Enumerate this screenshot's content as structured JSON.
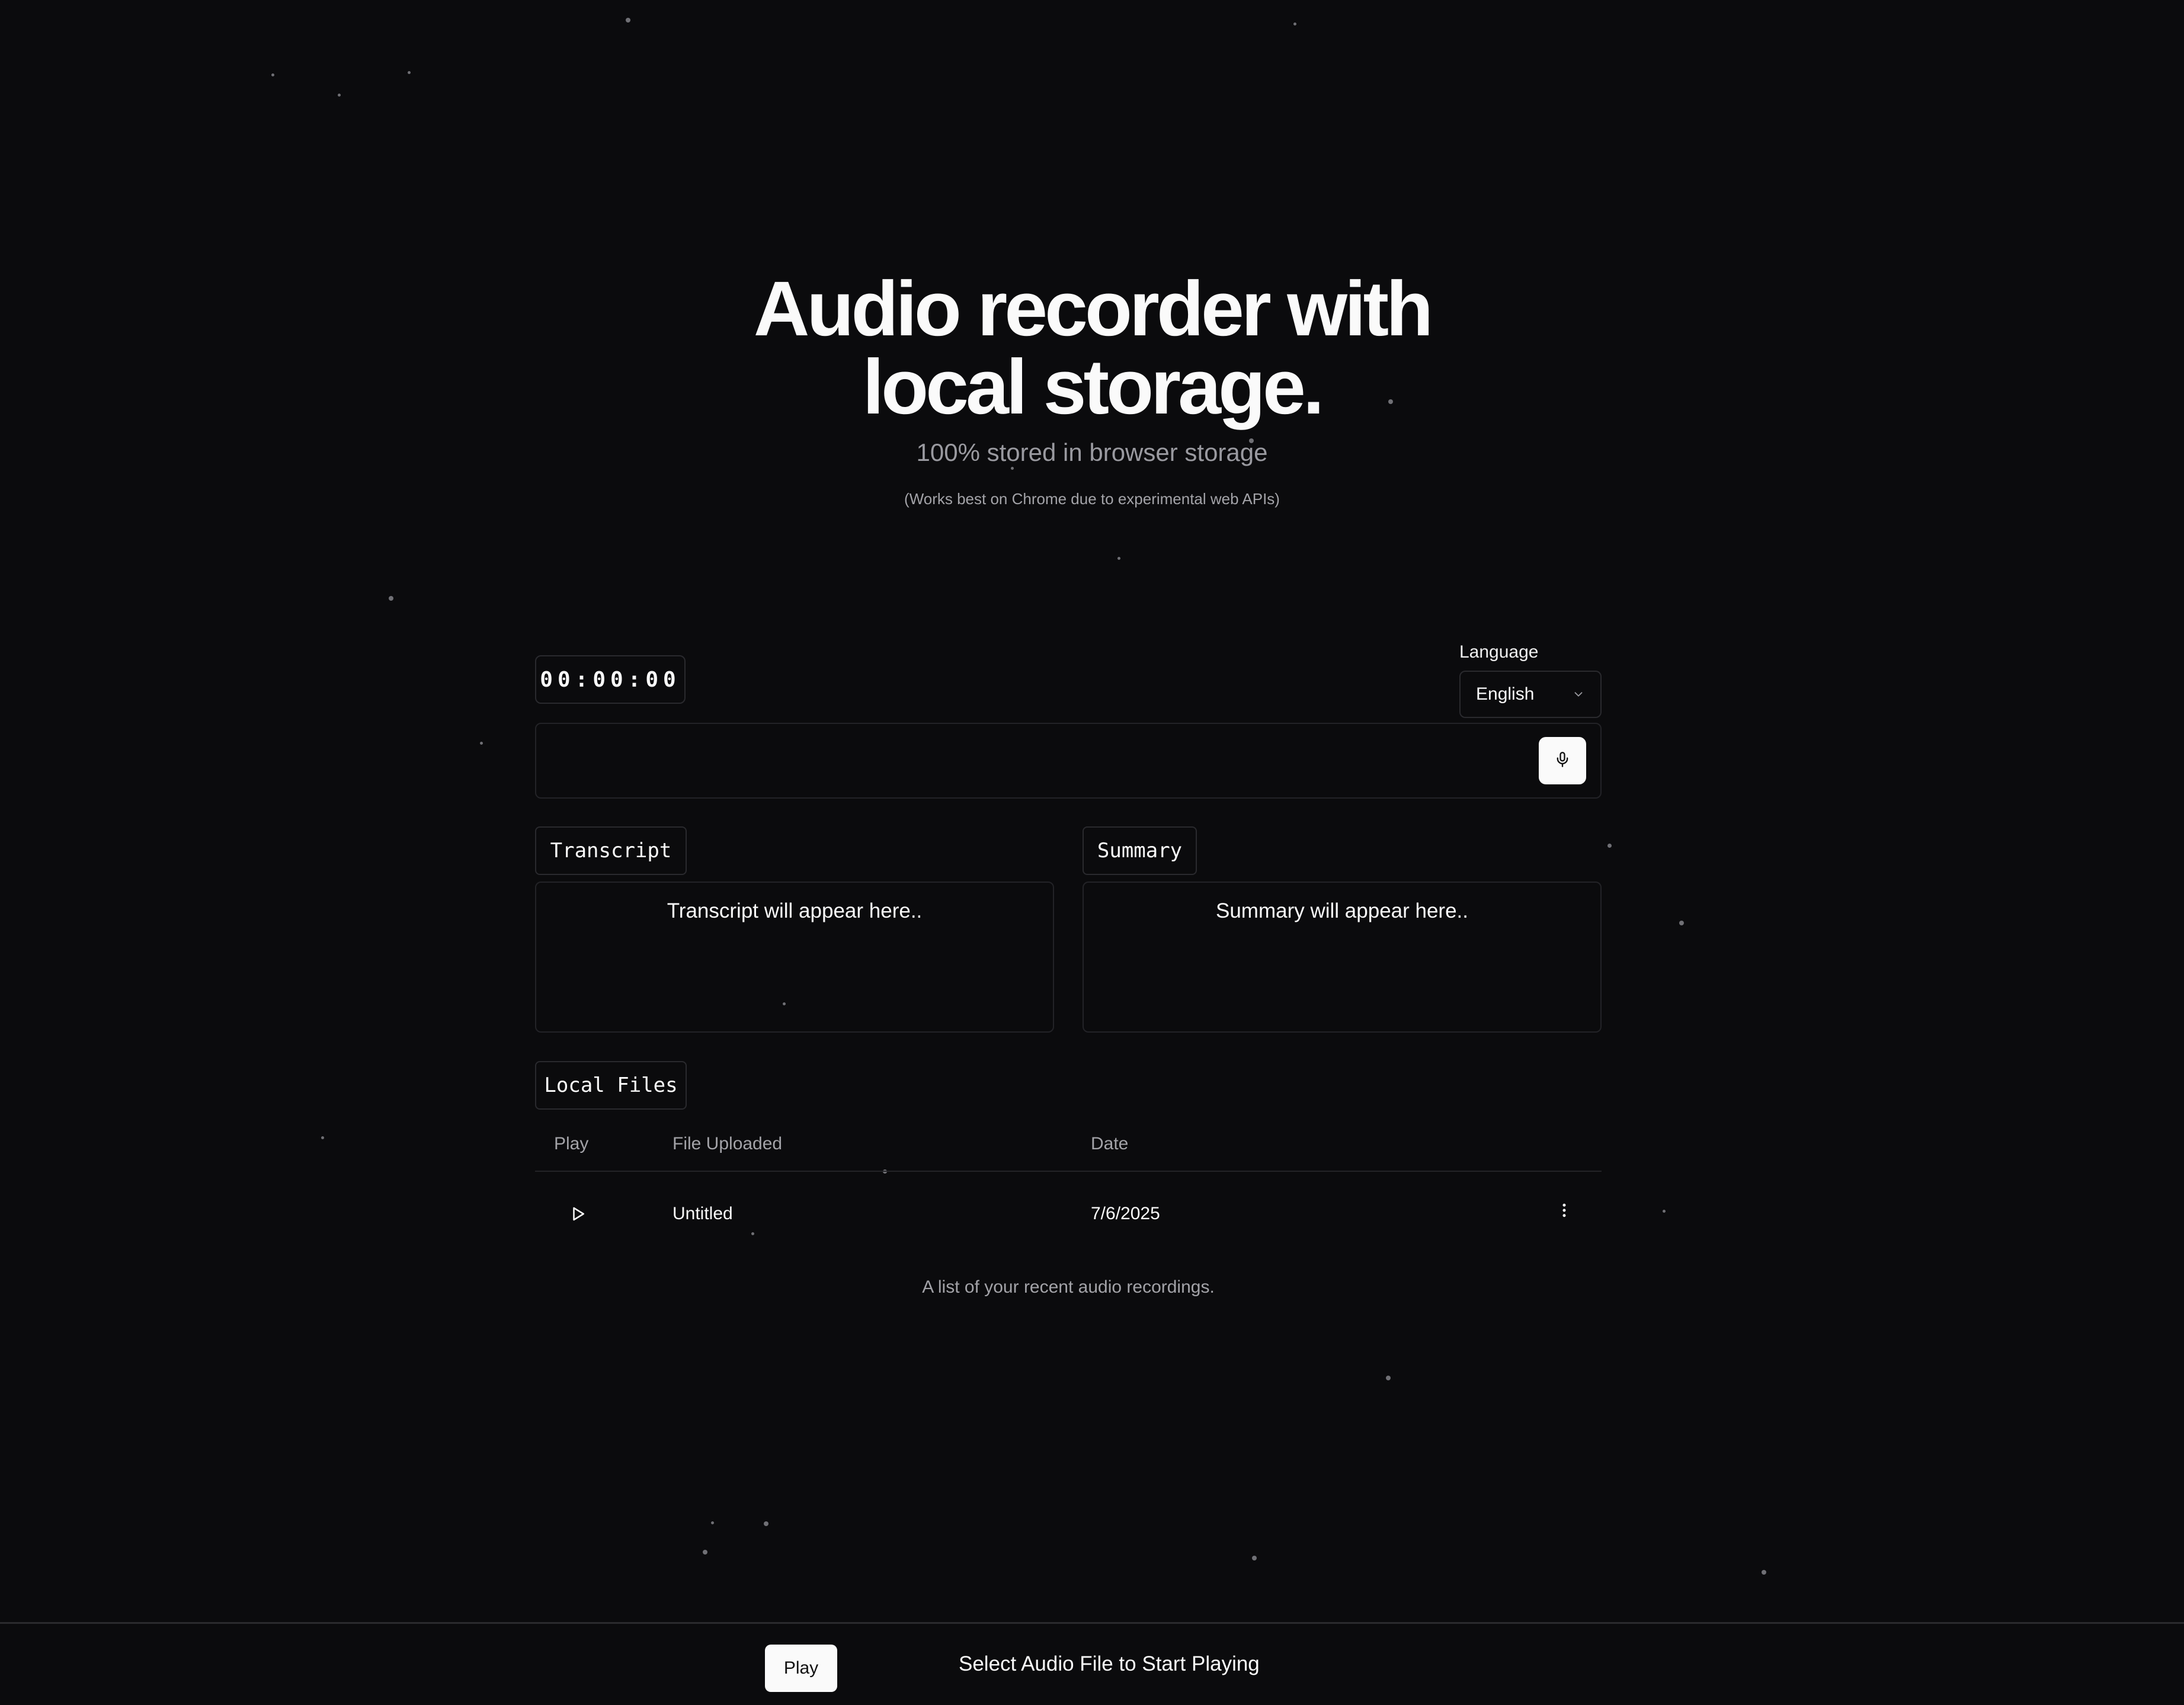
{
  "hero": {
    "title_line1": "Audio recorder with",
    "title_line2": "local storage.",
    "subtitle": "100% stored in browser storage",
    "note": "(Works best on Chrome due to experimental web APIs)"
  },
  "recorder": {
    "timer": "00:00:00",
    "language_label": "Language",
    "language_value": "English",
    "mic_icon": "microphone-icon"
  },
  "transcript": {
    "tag": "Transcript",
    "placeholder": "Transcript will appear here.."
  },
  "summary": {
    "tag": "Summary",
    "placeholder": "Summary will appear here.."
  },
  "local_files": {
    "tag": "Local Files",
    "columns": [
      "Play",
      "File Uploaded",
      "Date"
    ],
    "rows": [
      {
        "name": "Untitled",
        "date": "7/6/2025"
      }
    ],
    "caption": "A list of your recent audio recordings."
  },
  "player": {
    "play_label": "Play",
    "status": "Select Audio File to Start Playing"
  },
  "colors": {
    "background": "#0b0b0d",
    "foreground": "#fafafa",
    "muted": "#a3a3a8",
    "border": "#2a2a2e"
  }
}
